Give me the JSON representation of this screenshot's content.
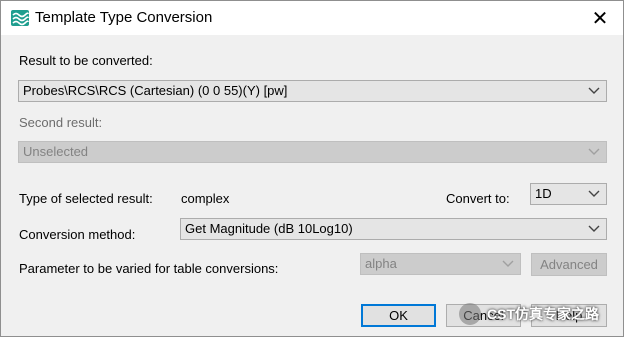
{
  "window": {
    "title": "Template Type Conversion",
    "close_glyph": "✕"
  },
  "result_label": "Result to be converted:",
  "result_value": "Probes\\RCS\\RCS (Cartesian) (0 0 55)(Y) [pw]",
  "second_label": "Second result:",
  "second_value": "Unselected",
  "type_label": "Type of selected result:",
  "type_value": "complex",
  "convert_to_label": "Convert to:",
  "convert_to_value": "1D",
  "method_label": "Conversion method:",
  "method_value": "Get Magnitude (dB 10Log10)",
  "param_label": "Parameter to be varied for table conversions:",
  "param_value": "alpha",
  "buttons": {
    "advanced": "Advanced",
    "ok": "OK",
    "cancel": "Cancel",
    "help": "Help"
  },
  "watermark": {
    "text": "CST仿真专家之路"
  },
  "colors": {
    "accent": "#0078d7",
    "icon": "#1f9e8f",
    "disabled_text": "#838383"
  }
}
